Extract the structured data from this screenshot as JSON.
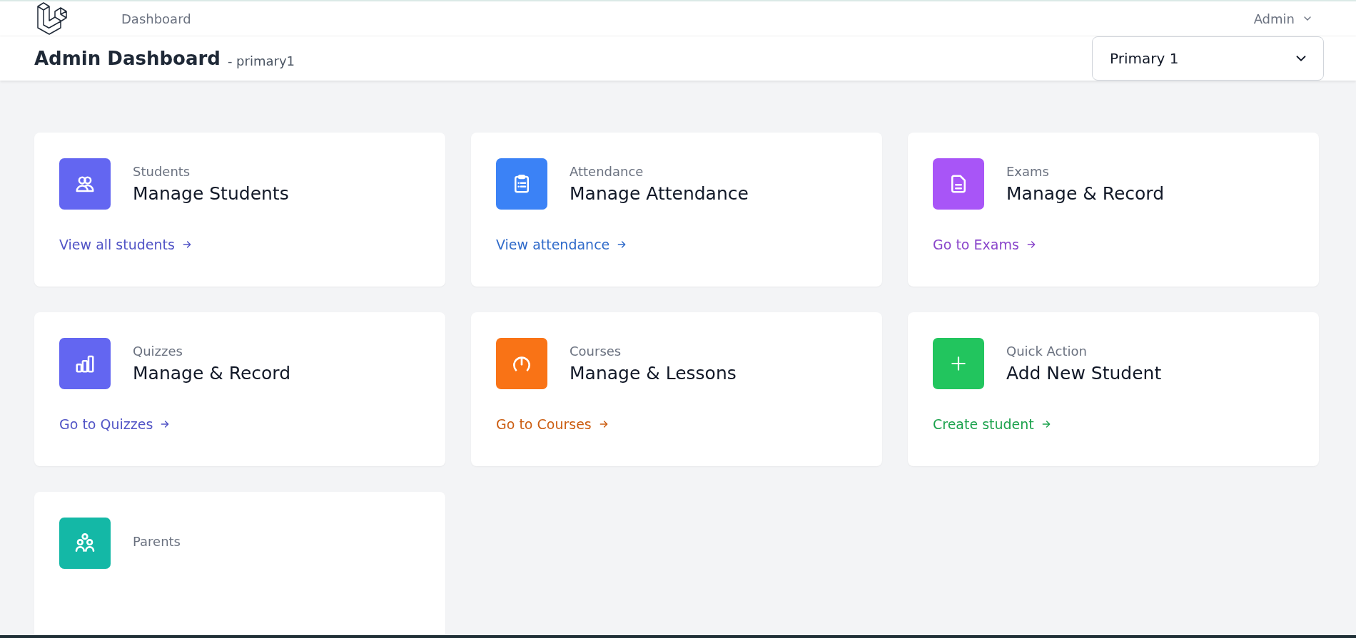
{
  "nav": {
    "links": [
      {
        "label": "Dashboard",
        "selected": false
      }
    ],
    "user": "Admin"
  },
  "header": {
    "title": "Admin Dashboard",
    "subtitle": "- primary1",
    "class_select": {
      "value": "Primary 1"
    }
  },
  "cards": [
    {
      "kind": "students",
      "color": "#6366f1",
      "label": "Students",
      "title": "Manage Students",
      "link": "View all students"
    },
    {
      "kind": "attendance",
      "color": "#3b82f6",
      "label": "Attendance",
      "title": "Manage Attendance",
      "link": "View attendance"
    },
    {
      "kind": "exams",
      "color": "#a855f7",
      "label": "Exams",
      "title": "Manage & Record",
      "link": "Go to Exams"
    },
    {
      "kind": "quizzes",
      "color": "#6366f1",
      "label": "Quizzes",
      "title": "Manage & Record",
      "link": "Go to Quizzes"
    },
    {
      "kind": "courses",
      "color": "#f97316",
      "label": "Courses",
      "title": "Manage & Lessons",
      "link": "Go to Courses"
    },
    {
      "kind": "add",
      "color": "#22c55e",
      "label": "Quick Action",
      "title": "Add New Student",
      "link": "Create student"
    },
    {
      "kind": "parents",
      "color": "#14b8a6",
      "label": "Parents"
    }
  ]
}
